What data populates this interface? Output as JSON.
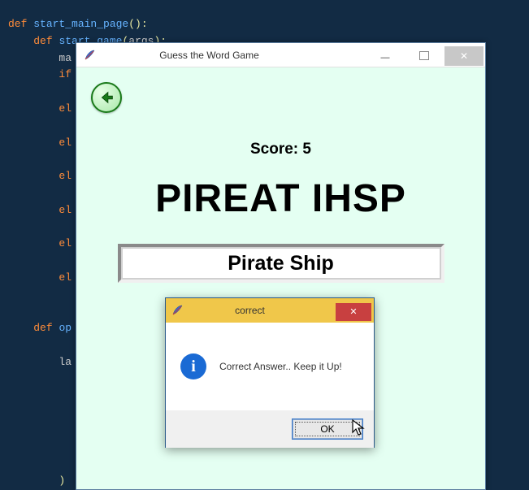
{
  "editor": {
    "lines": [
      {
        "indent": 0,
        "segs": [
          [
            "kw",
            "def "
          ],
          [
            "id",
            "start_main_page"
          ],
          [
            "paren",
            "():"
          ]
        ]
      },
      {
        "indent": 1,
        "segs": [
          [
            "kw",
            "def "
          ],
          [
            "id",
            "start_game"
          ],
          [
            "paren",
            "("
          ],
          [
            "",
            "args"
          ],
          [
            "paren",
            "):"
          ]
        ]
      },
      {
        "indent": 2,
        "segs": [
          [
            "",
            "ma"
          ]
        ]
      },
      {
        "indent": 2,
        "segs": [
          [
            "kw",
            "if"
          ]
        ]
      },
      {
        "indent": 0,
        "segs": [
          [
            "",
            ""
          ]
        ]
      },
      {
        "indent": 2,
        "segs": [
          [
            "kw",
            "el"
          ]
        ]
      },
      {
        "indent": 0,
        "segs": [
          [
            "",
            ""
          ]
        ]
      },
      {
        "indent": 2,
        "segs": [
          [
            "kw",
            "el"
          ]
        ]
      },
      {
        "indent": 0,
        "segs": [
          [
            "",
            ""
          ]
        ]
      },
      {
        "indent": 2,
        "segs": [
          [
            "kw",
            "el"
          ]
        ]
      },
      {
        "indent": 0,
        "segs": [
          [
            "",
            ""
          ]
        ]
      },
      {
        "indent": 2,
        "segs": [
          [
            "kw",
            "el"
          ]
        ]
      },
      {
        "indent": 0,
        "segs": [
          [
            "",
            ""
          ]
        ]
      },
      {
        "indent": 2,
        "segs": [
          [
            "kw",
            "el"
          ]
        ]
      },
      {
        "indent": 0,
        "segs": [
          [
            "",
            ""
          ]
        ]
      },
      {
        "indent": 2,
        "segs": [
          [
            "kw",
            "el"
          ]
        ]
      },
      {
        "indent": 0,
        "segs": [
          [
            "",
            ""
          ]
        ]
      },
      {
        "indent": 0,
        "segs": [
          [
            "",
            ""
          ]
        ]
      },
      {
        "indent": 1,
        "segs": [
          [
            "kw",
            "def "
          ],
          [
            "id",
            "op"
          ]
        ]
      },
      {
        "indent": 0,
        "segs": [
          [
            "",
            ""
          ]
        ]
      },
      {
        "indent": 2,
        "segs": [
          [
            "",
            "la"
          ]
        ]
      },
      {
        "indent": 0,
        "segs": [
          [
            "",
            ""
          ]
        ]
      },
      {
        "indent": 0,
        "segs": [
          [
            "",
            ""
          ]
        ]
      },
      {
        "indent": 0,
        "segs": [
          [
            "",
            ""
          ]
        ]
      },
      {
        "indent": 0,
        "segs": [
          [
            "",
            ""
          ]
        ]
      },
      {
        "indent": 0,
        "segs": [
          [
            "",
            ""
          ]
        ]
      },
      {
        "indent": 0,
        "segs": [
          [
            "",
            ""
          ]
        ]
      },
      {
        "indent": 2,
        "segs": [
          [
            "paren",
            ")"
          ]
        ]
      }
    ]
  },
  "window": {
    "title": "Guess the Word Game"
  },
  "game": {
    "score_label": "Score: 5",
    "scrambled": "PIREAT IHSP",
    "answer": "Pirate Ship"
  },
  "dialog": {
    "title": "correct",
    "message": "Correct Answer.. Keep it Up!",
    "ok_label": "OK"
  }
}
